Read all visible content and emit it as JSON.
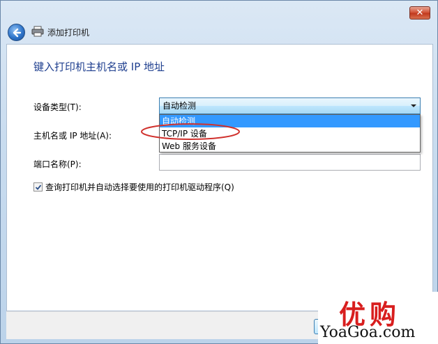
{
  "window": {
    "title": "添加打印机",
    "close_glyph": "✕"
  },
  "page": {
    "heading": "键入打印机主机名或 IP 地址"
  },
  "form": {
    "device_type_label": "设备类型(T):",
    "device_type_value": "自动检测",
    "device_type_options": [
      "自动检测",
      "TCP/IP 设备",
      "Web 服务设备"
    ],
    "hostname_label": "主机名或 IP 地址(A):",
    "hostname_value": "",
    "port_label": "端口名称(P):",
    "port_value": "",
    "auto_driver_checkbox_label": "查询打印机并自动选择要使用的打印机驱动程序(Q)",
    "auto_driver_checked": true
  },
  "watermark": {
    "chars": "优购",
    "url": "YoaGoa.com"
  },
  "colors": {
    "heading": "#1f3f8f",
    "selection": "#3399ff",
    "annotation": "#d0312d",
    "watermark_red": "#d81e1e"
  },
  "icons": {
    "back": "back-arrow-icon",
    "printer": "printer-icon",
    "close": "close-icon",
    "checkbox": "checkmark-icon",
    "dropdown": "chevron-down-icon"
  }
}
